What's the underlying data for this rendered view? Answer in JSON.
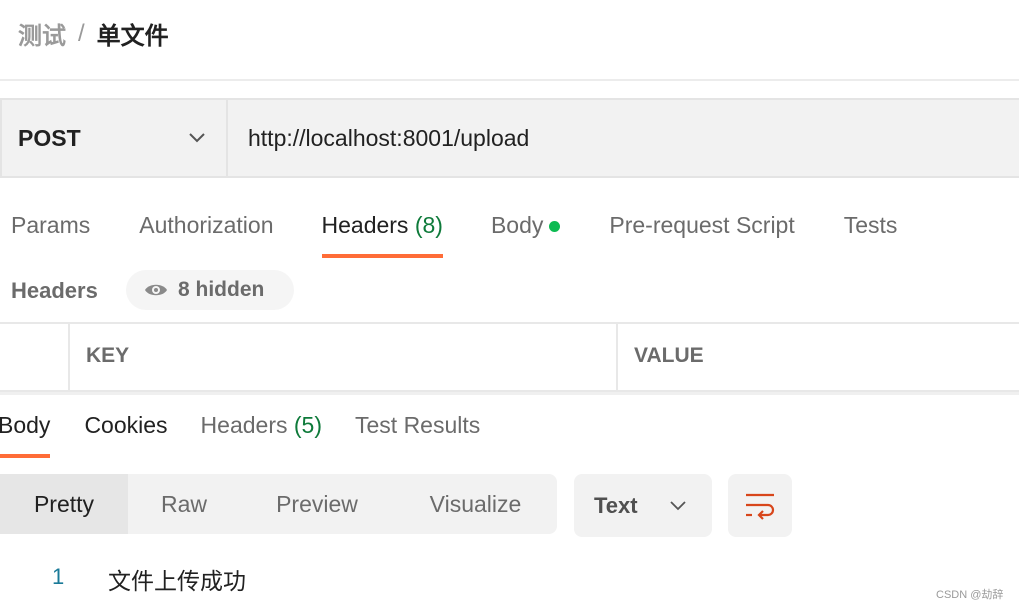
{
  "breadcrumb": {
    "parent": "测试",
    "separator": "/",
    "current": "单文件"
  },
  "request": {
    "method": "POST",
    "url": "http://localhost:8001/upload"
  },
  "request_tabs": [
    {
      "label": "Params"
    },
    {
      "label": "Authorization"
    },
    {
      "label": "Headers",
      "count": "(8)",
      "active": true
    },
    {
      "label": "Body",
      "indicator": "green-dot"
    },
    {
      "label": "Pre-request Script"
    },
    {
      "label": "Tests"
    }
  ],
  "headers_section": {
    "title": "Headers",
    "hidden_label": "8 hidden",
    "icon": "eye-icon"
  },
  "table": {
    "columns": [
      "KEY",
      "VALUE"
    ]
  },
  "response_tabs": [
    {
      "label": "Body",
      "active": true
    },
    {
      "label": "Cookies"
    },
    {
      "label": "Headers",
      "count": "(5)"
    },
    {
      "label": "Test Results"
    }
  ],
  "view_modes": [
    "Pretty",
    "Raw",
    "Preview",
    "Visualize"
  ],
  "selected_view": "Pretty",
  "format": "Text",
  "wrap_icon": "wrap-lines-icon",
  "body_lines": [
    {
      "number": "1",
      "text": "文件上传成功"
    }
  ],
  "watermark": "CSDN @劫辞",
  "colors": {
    "accent": "#ff6c37",
    "count_green": "#0e7a3a",
    "dot_green": "#0cbb52"
  }
}
